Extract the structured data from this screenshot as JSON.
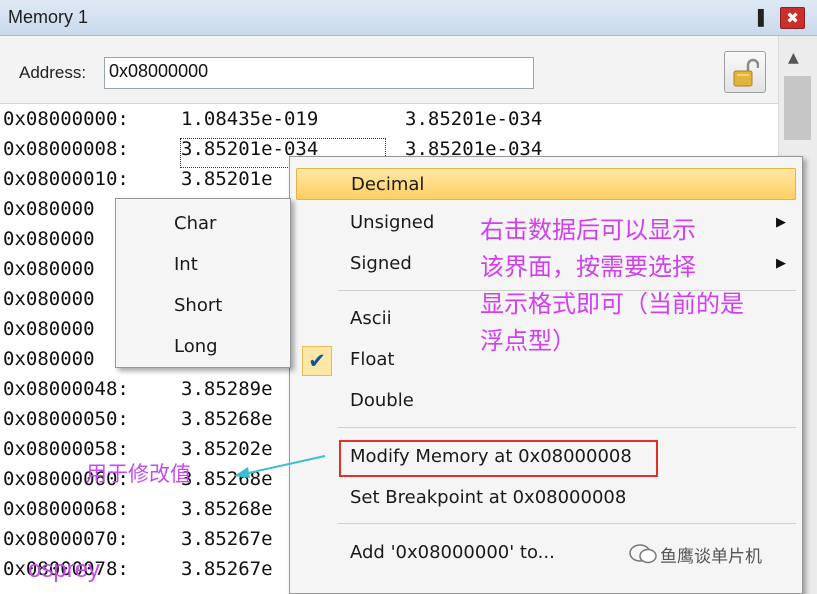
{
  "window": {
    "title": "Memory 1",
    "pin_glyph": "▐",
    "close_glyph": "✖"
  },
  "address": {
    "label": "Address:",
    "value": "0x08000000"
  },
  "memory_rows": [
    {
      "addr": "0x08000000:",
      "v1": "1.08435e-019",
      "v2": "3.85201e-034"
    },
    {
      "addr": "0x08000008:",
      "v1": "3.85201e-034",
      "v2": "3.85201e-034"
    },
    {
      "addr": "0x08000010:",
      "v1": "3.85201e",
      "v2": ""
    },
    {
      "addr": "0x080000",
      "v1": "",
      "v2": ""
    },
    {
      "addr": "0x080000",
      "v1": "",
      "v2": ""
    },
    {
      "addr": "0x080000",
      "v1": "",
      "v2": ""
    },
    {
      "addr": "0x080000",
      "v1": "",
      "v2": ""
    },
    {
      "addr": "0x080000",
      "v1": "",
      "v2": ""
    },
    {
      "addr": "0x080000",
      "v1": "",
      "v2": ""
    },
    {
      "addr": "0x08000048:",
      "v1": "3.85289e",
      "v2": ""
    },
    {
      "addr": "0x08000050:",
      "v1": "3.85268e",
      "v2": ""
    },
    {
      "addr": "0x08000058:",
      "v1": "3.85202e",
      "v2": ""
    },
    {
      "addr": "0x08000060:",
      "v1": "3.85268e",
      "v2": ""
    },
    {
      "addr": "0x08000068:",
      "v1": "3.85268e",
      "v2": ""
    },
    {
      "addr": "0x08000070:",
      "v1": "3.85267e",
      "v2": ""
    },
    {
      "addr": "0x08000078:",
      "v1": "3.85267e",
      "v2": ""
    }
  ],
  "context_menu": {
    "items": [
      {
        "label": "Decimal"
      },
      {
        "label": "Unsigned"
      },
      {
        "label": "Signed"
      },
      {
        "label": "Ascii"
      },
      {
        "label": "Float"
      },
      {
        "label": "Double"
      },
      {
        "label": "Modify Memory at 0x08000008"
      },
      {
        "label": "Set Breakpoint at 0x08000008"
      },
      {
        "label": "Add '0x08000000' to..."
      }
    ],
    "check_glyph": "✔",
    "arrow_glyph": "▶",
    "checked_item": "Float"
  },
  "submenu": {
    "items": [
      "Char",
      "Int",
      "Short",
      "Long"
    ]
  },
  "annotations": {
    "note_lines": [
      "右击数据后可以显示",
      "该界面，按需要选择",
      "显示格式即可（当前的是",
      "浮点型）"
    ],
    "modify_note": "用于修改值",
    "author": "osprey",
    "watermark": "鱼鹰谈单片机"
  },
  "colors": {
    "highlight": "#ffcf61",
    "annotation_pink": "#d23ff0",
    "red_box": "#e0302a",
    "arrow_teal": "#3bbfd0"
  }
}
